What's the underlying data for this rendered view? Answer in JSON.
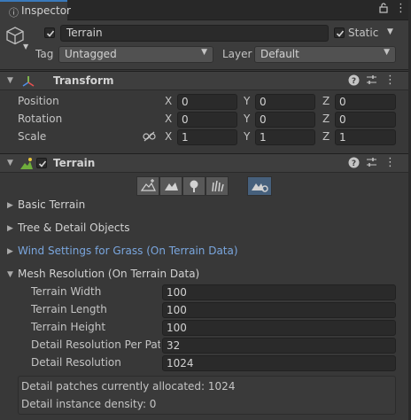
{
  "tab": {
    "title": "Inspector"
  },
  "gameobject": {
    "name": "Terrain",
    "static_label": "Static",
    "tag_label": "Tag",
    "tag_value": "Untagged",
    "layer_label": "Layer",
    "layer_value": "Default"
  },
  "transform": {
    "title": "Transform",
    "rows": [
      {
        "label": "Position",
        "x": "0",
        "y": "0",
        "z": "0"
      },
      {
        "label": "Rotation",
        "x": "0",
        "y": "0",
        "z": "0"
      },
      {
        "label": "Scale",
        "x": "1",
        "y": "1",
        "z": "1"
      }
    ],
    "axis_x": "X",
    "axis_y": "Y",
    "axis_z": "Z"
  },
  "terrain": {
    "title": "Terrain",
    "foldouts": {
      "basic": "Basic Terrain",
      "trees": "Tree & Detail Objects",
      "wind": "Wind Settings for Grass (On Terrain Data)",
      "mesh": "Mesh Resolution (On Terrain Data)"
    },
    "mesh_fields": [
      {
        "label": "Terrain Width",
        "value": "100"
      },
      {
        "label": "Terrain Length",
        "value": "100"
      },
      {
        "label": "Terrain Height",
        "value": "100"
      },
      {
        "label": "Detail Resolution Per Patc",
        "value": "32"
      },
      {
        "label": "Detail Resolution",
        "value": "1024"
      }
    ],
    "info_lines": [
      "Detail patches currently allocated: 1024",
      "Detail instance density: 0"
    ]
  },
  "colors": {
    "accent": "#3a79bb",
    "link": "#7aa6de",
    "toolbar_active": "#46607c"
  },
  "icons": [
    "info-icon",
    "lock-icon",
    "menu-icon",
    "cube-icon",
    "help-icon",
    "preset-icon",
    "kebab-icon",
    "transform-axis-icon",
    "terrain-icon",
    "link-scale-icon"
  ]
}
